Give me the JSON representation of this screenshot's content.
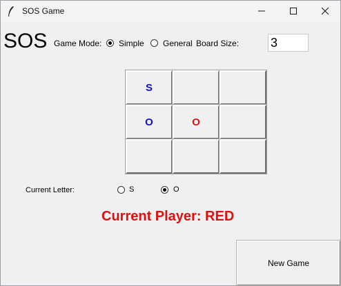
{
  "window": {
    "title": "SOS Game",
    "icons": {
      "app": "feather-icon",
      "minimize": "minimize-icon",
      "maximize": "maximize-icon",
      "close": "close-icon"
    }
  },
  "header": {
    "sos_label": "SOS",
    "game_mode_label": "Game Mode:",
    "modes": [
      {
        "label": "Simple",
        "checked": true
      },
      {
        "label": "General",
        "checked": false
      }
    ],
    "board_size_label": "Board Size:",
    "board_size_value": "3"
  },
  "board": {
    "cells": [
      {
        "letter": "S",
        "color": "#1010c0"
      },
      {
        "letter": "",
        "color": "#000000"
      },
      {
        "letter": "",
        "color": "#000000"
      },
      {
        "letter": "O",
        "color": "#1010c0"
      },
      {
        "letter": "O",
        "color": "#e01010"
      },
      {
        "letter": "",
        "color": "#000000"
      },
      {
        "letter": "",
        "color": "#000000"
      },
      {
        "letter": "",
        "color": "#000000"
      },
      {
        "letter": "",
        "color": "#000000"
      }
    ]
  },
  "letter_selector": {
    "label": "Current Letter:",
    "options": [
      {
        "label": "S",
        "checked": false
      },
      {
        "label": "O",
        "checked": true
      }
    ]
  },
  "status": {
    "current_player": "Current Player: RED",
    "color": "#e01010"
  },
  "actions": {
    "new_game_label": "New Game"
  }
}
